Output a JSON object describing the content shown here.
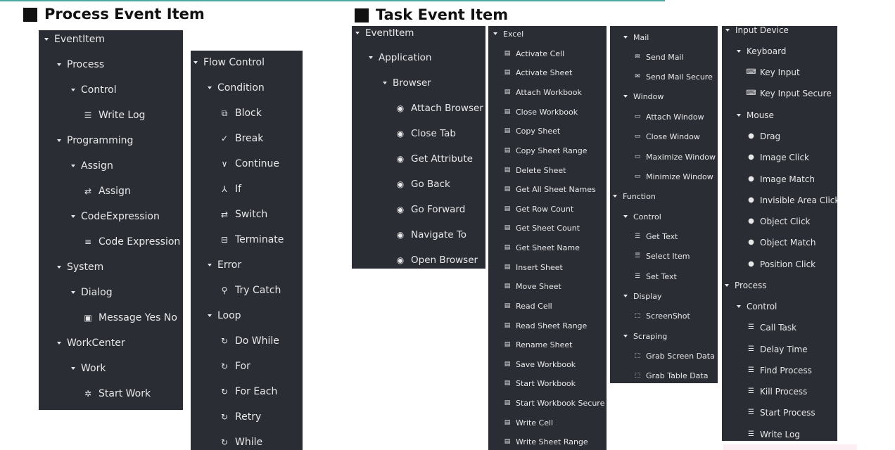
{
  "titles": {
    "process_event_item": "Process Event Item",
    "task_event_item": "Task Event Item"
  },
  "panel1": [
    {
      "label": "EventItem",
      "type": "folder"
    },
    {
      "label": "Process",
      "type": "folder"
    },
    {
      "label": "Control",
      "type": "folder"
    },
    {
      "label": "Write Log",
      "type": "item",
      "icon": "sliders-icon"
    },
    {
      "label": "Programming",
      "type": "folder"
    },
    {
      "label": "Assign",
      "type": "folder"
    },
    {
      "label": "Assign",
      "type": "item",
      "icon": "swap-icon"
    },
    {
      "label": "CodeExpression",
      "type": "folder"
    },
    {
      "label": "Code Expression",
      "type": "item",
      "icon": "lines-icon"
    },
    {
      "label": "System",
      "type": "folder"
    },
    {
      "label": "Dialog",
      "type": "folder"
    },
    {
      "label": "Message Yes No",
      "type": "item",
      "icon": "dialog-icon"
    },
    {
      "label": "WorkCenter",
      "type": "folder"
    },
    {
      "label": "Work",
      "type": "folder"
    },
    {
      "label": "Start Work",
      "type": "item",
      "icon": "gear-icon"
    }
  ],
  "panel2": [
    {
      "label": "Flow Control",
      "type": "folder"
    },
    {
      "label": "Condition",
      "type": "folder"
    },
    {
      "label": "Block",
      "type": "item",
      "icon": "block-icon"
    },
    {
      "label": "Break",
      "type": "item",
      "icon": "break-icon"
    },
    {
      "label": "Continue",
      "type": "item",
      "icon": "chevron-down-icon"
    },
    {
      "label": "If",
      "type": "item",
      "icon": "branch-icon"
    },
    {
      "label": "Switch",
      "type": "item",
      "icon": "switch-icon"
    },
    {
      "label": "Terminate",
      "type": "item",
      "icon": "terminate-icon"
    },
    {
      "label": "Error",
      "type": "folder"
    },
    {
      "label": "Try Catch",
      "type": "item",
      "icon": "try-catch-icon"
    },
    {
      "label": "Loop",
      "type": "folder"
    },
    {
      "label": "Do While",
      "type": "item",
      "icon": "loop-icon"
    },
    {
      "label": "For",
      "type": "item",
      "icon": "loop-icon"
    },
    {
      "label": "For Each",
      "type": "item",
      "icon": "loop-icon"
    },
    {
      "label": "Retry",
      "type": "item",
      "icon": "loop-icon"
    },
    {
      "label": "While",
      "type": "item",
      "icon": "loop-icon"
    }
  ],
  "panel3": [
    {
      "label": "EventItem",
      "type": "folder"
    },
    {
      "label": "Application",
      "type": "folder"
    },
    {
      "label": "Browser",
      "type": "folder"
    },
    {
      "label": "Attach Browser",
      "type": "item",
      "icon": "compass-icon"
    },
    {
      "label": "Close Tab",
      "type": "item",
      "icon": "compass-icon"
    },
    {
      "label": "Get Attribute",
      "type": "item",
      "icon": "compass-icon"
    },
    {
      "label": "Go Back",
      "type": "item",
      "icon": "compass-icon"
    },
    {
      "label": "Go Forward",
      "type": "item",
      "icon": "compass-icon"
    },
    {
      "label": "Navigate To",
      "type": "item",
      "icon": "compass-icon"
    },
    {
      "label": "Open Browser",
      "type": "item",
      "icon": "compass-icon"
    }
  ],
  "panel4": [
    {
      "label": "Excel",
      "type": "folder"
    },
    {
      "label": "Activate Cell",
      "type": "item",
      "icon": "file-icon"
    },
    {
      "label": "Activate Sheet",
      "type": "item",
      "icon": "file-icon"
    },
    {
      "label": "Attach Workbook",
      "type": "item",
      "icon": "file-icon"
    },
    {
      "label": "Close Workbook",
      "type": "item",
      "icon": "file-icon"
    },
    {
      "label": "Copy Sheet",
      "type": "item",
      "icon": "file-icon"
    },
    {
      "label": "Copy Sheet Range",
      "type": "item",
      "icon": "file-icon"
    },
    {
      "label": "Delete Sheet",
      "type": "item",
      "icon": "file-icon"
    },
    {
      "label": "Get All Sheet Names",
      "type": "item",
      "icon": "file-icon"
    },
    {
      "label": "Get Row Count",
      "type": "item",
      "icon": "file-icon"
    },
    {
      "label": "Get Sheet Count",
      "type": "item",
      "icon": "file-icon"
    },
    {
      "label": "Get Sheet Name",
      "type": "item",
      "icon": "file-icon"
    },
    {
      "label": "Insert Sheet",
      "type": "item",
      "icon": "file-icon"
    },
    {
      "label": "Move Sheet",
      "type": "item",
      "icon": "file-icon"
    },
    {
      "label": "Read Cell",
      "type": "item",
      "icon": "file-icon"
    },
    {
      "label": "Read Sheet Range",
      "type": "item",
      "icon": "file-icon"
    },
    {
      "label": "Rename Sheet",
      "type": "item",
      "icon": "file-icon"
    },
    {
      "label": "Save Workbook",
      "type": "item",
      "icon": "file-icon"
    },
    {
      "label": "Start Workbook",
      "type": "item",
      "icon": "file-icon"
    },
    {
      "label": "Start Workbook Secure",
      "type": "item",
      "icon": "file-icon"
    },
    {
      "label": "Write Cell",
      "type": "item",
      "icon": "file-icon"
    },
    {
      "label": "Write Sheet Range",
      "type": "item",
      "icon": "file-icon"
    }
  ],
  "panel5": [
    {
      "label": "Mail",
      "type": "folder"
    },
    {
      "label": "Send Mail",
      "type": "item",
      "icon": "mail-icon"
    },
    {
      "label": "Send Mail Secure",
      "type": "item",
      "icon": "mail-icon"
    },
    {
      "label": "Window",
      "type": "folder"
    },
    {
      "label": "Attach Window",
      "type": "item",
      "icon": "window-icon"
    },
    {
      "label": "Close Window",
      "type": "item",
      "icon": "window-icon"
    },
    {
      "label": "Maximize Window",
      "type": "item",
      "icon": "window-icon"
    },
    {
      "label": "Minimize Window",
      "type": "item",
      "icon": "window-icon"
    },
    {
      "label": "Function",
      "type": "folder"
    },
    {
      "label": "Control",
      "type": "folder"
    },
    {
      "label": "Get Text",
      "type": "item",
      "icon": "sliders-icon"
    },
    {
      "label": "Select Item",
      "type": "item",
      "icon": "sliders-icon"
    },
    {
      "label": "Set Text",
      "type": "item",
      "icon": "sliders-icon"
    },
    {
      "label": "Display",
      "type": "folder"
    },
    {
      "label": "ScreenShot",
      "type": "item",
      "icon": "screenshot-icon"
    },
    {
      "label": "Scraping",
      "type": "folder"
    },
    {
      "label": "Grab Screen Data",
      "type": "item",
      "icon": "grab-icon"
    },
    {
      "label": "Grab Table Data",
      "type": "item",
      "icon": "grab-icon"
    }
  ],
  "panel6": [
    {
      "label": "Input Device",
      "type": "folder"
    },
    {
      "label": "Keyboard",
      "type": "folder"
    },
    {
      "label": "Key Input",
      "type": "item",
      "icon": "keyboard-icon"
    },
    {
      "label": "Key Input Secure",
      "type": "item",
      "icon": "keyboard-icon"
    },
    {
      "label": "Mouse",
      "type": "folder"
    },
    {
      "label": "Drag",
      "type": "item",
      "icon": "mouse-icon"
    },
    {
      "label": "Image Click",
      "type": "item",
      "icon": "mouse-icon"
    },
    {
      "label": "Image Match",
      "type": "item",
      "icon": "mouse-icon"
    },
    {
      "label": "Invisible Area Click",
      "type": "item",
      "icon": "mouse-icon"
    },
    {
      "label": "Object Click",
      "type": "item",
      "icon": "mouse-icon"
    },
    {
      "label": "Object Match",
      "type": "item",
      "icon": "mouse-icon"
    },
    {
      "label": "Position Click",
      "type": "item",
      "icon": "mouse-icon"
    },
    {
      "label": "Process",
      "type": "folder"
    },
    {
      "label": "Control",
      "type": "folder"
    },
    {
      "label": "Call Task",
      "type": "item",
      "icon": "sliders-icon"
    },
    {
      "label": "Delay Time",
      "type": "item",
      "icon": "sliders-icon"
    },
    {
      "label": "Find Process",
      "type": "item",
      "icon": "sliders-icon"
    },
    {
      "label": "Kill Process",
      "type": "item",
      "icon": "sliders-icon"
    },
    {
      "label": "Start Process",
      "type": "item",
      "icon": "sliders-icon"
    },
    {
      "label": "Write Log",
      "type": "item",
      "icon": "sliders-icon"
    }
  ]
}
